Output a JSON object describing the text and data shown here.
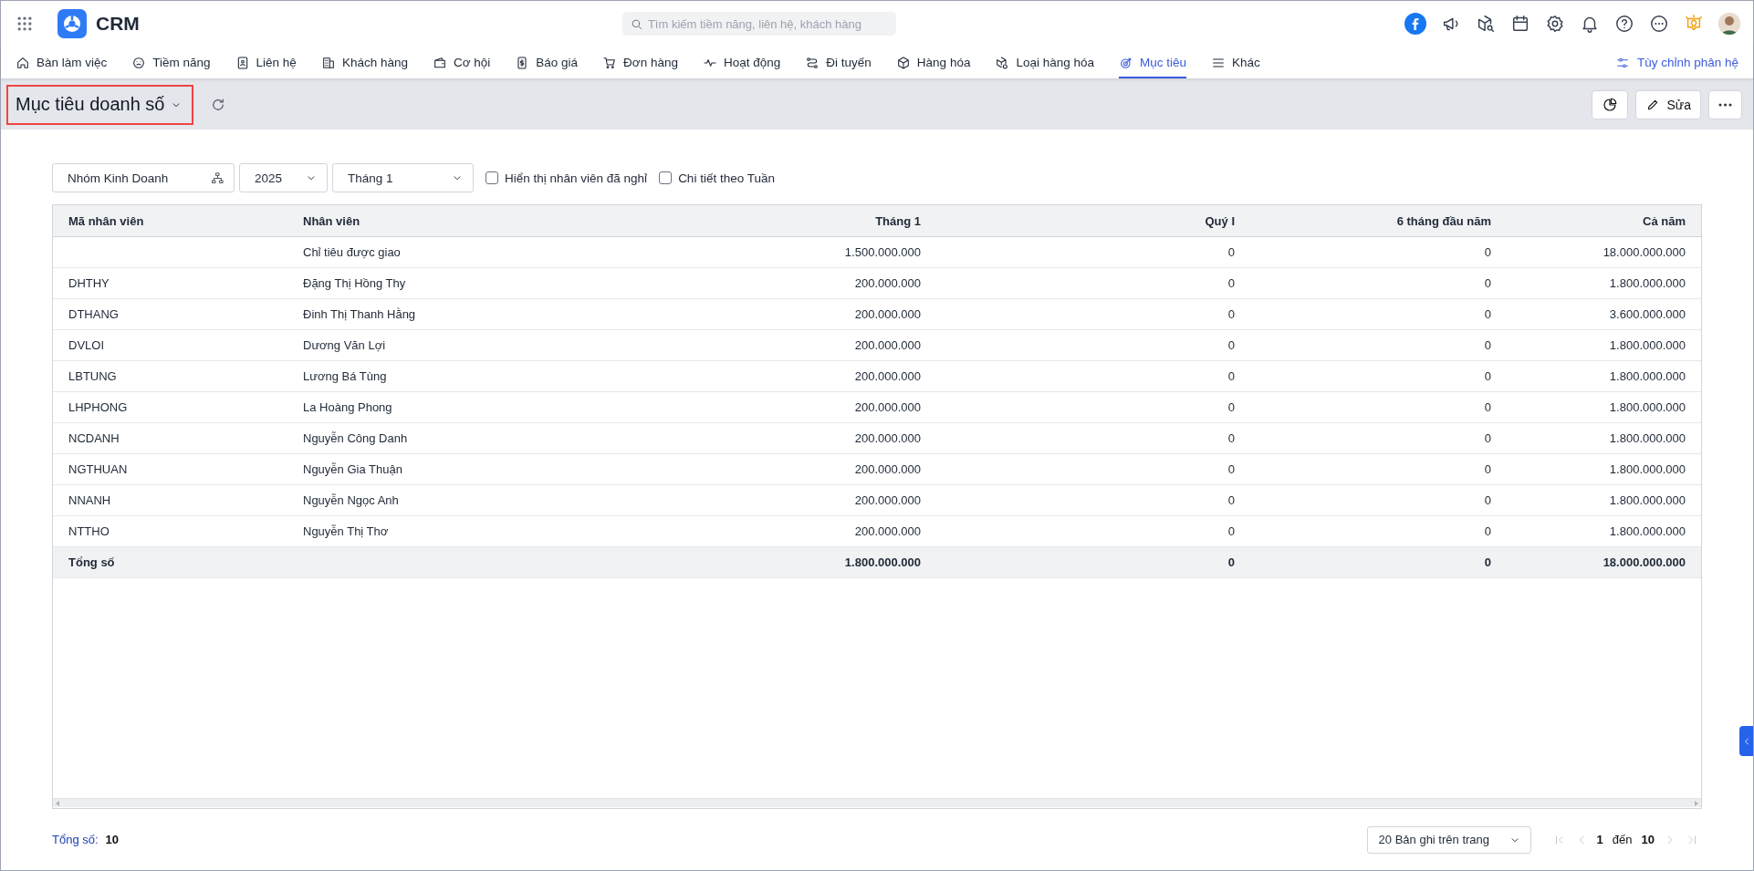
{
  "app": {
    "name": "CRM"
  },
  "search": {
    "placeholder": "Tìm kiếm tiềm năng, liên hệ, khách hàng"
  },
  "nav": [
    {
      "label": "Bàn làm việc",
      "selected": false
    },
    {
      "label": "Tiềm năng",
      "selected": false
    },
    {
      "label": "Liên hệ",
      "selected": false
    },
    {
      "label": "Khách hàng",
      "selected": false
    },
    {
      "label": "Cơ hội",
      "selected": false
    },
    {
      "label": "Báo giá",
      "selected": false
    },
    {
      "label": "Đơn hàng",
      "selected": false
    },
    {
      "label": "Hoạt động",
      "selected": false
    },
    {
      "label": "Đi tuyến",
      "selected": false
    },
    {
      "label": "Hàng hóa",
      "selected": false
    },
    {
      "label": "Loại hàng hóa",
      "selected": false
    },
    {
      "label": "Mục tiêu",
      "selected": true
    },
    {
      "label": "Khác",
      "selected": false
    }
  ],
  "customize": "Tùy chỉnh phân hệ",
  "toolbar": {
    "title": "Mục tiêu doanh số",
    "edit": "Sửa"
  },
  "filters": {
    "group": "Nhóm Kinh Doanh",
    "year": "2025",
    "period": "Tháng 1",
    "options": [
      {
        "label": "Hiển thị nhân viên đã nghỉ",
        "checked": false
      },
      {
        "label": "Chi tiết theo Tuần",
        "checked": false
      }
    ]
  },
  "table": {
    "columns": [
      "Mã nhân viên",
      "Nhân viên",
      "Tháng 1",
      "Quý I",
      "6 tháng đầu năm",
      "Cả năm"
    ],
    "rows": [
      {
        "name": "Chỉ tiêu được giao",
        "month": "1.500.000.000",
        "quarter": "0",
        "half": "0",
        "year": "18.000.000.000"
      },
      {
        "code": "DHTHY",
        "name": "Đặng Thị Hồng Thy",
        "month": "200.000.000",
        "quarter": "0",
        "half": "0",
        "year": "1.800.000.000"
      },
      {
        "code": "DTHANG",
        "name": "Đinh Thị Thanh Hằng",
        "month": "200.000.000",
        "quarter": "0",
        "half": "0",
        "year": "3.600.000.000"
      },
      {
        "code": "DVLOI",
        "name": "Dương Văn Lợi",
        "month": "200.000.000",
        "quarter": "0",
        "half": "0",
        "year": "1.800.000.000"
      },
      {
        "code": "LBTUNG",
        "name": "Lương Bá Tùng",
        "month": "200.000.000",
        "quarter": "0",
        "half": "0",
        "year": "1.800.000.000"
      },
      {
        "code": "LHPHONG",
        "name": "La Hoàng Phong",
        "month": "200.000.000",
        "quarter": "0",
        "half": "0",
        "year": "1.800.000.000"
      },
      {
        "code": "NCDANH",
        "name": "Nguyễn Công Danh",
        "month": "200.000.000",
        "quarter": "0",
        "half": "0",
        "year": "1.800.000.000"
      },
      {
        "code": "NGTHUAN",
        "name": "Nguyễn Gia Thuận",
        "month": "200.000.000",
        "quarter": "0",
        "half": "0",
        "year": "1.800.000.000"
      },
      {
        "code": "NNANH",
        "name": "Nguyễn Ngọc Anh",
        "month": "200.000.000",
        "quarter": "0",
        "half": "0",
        "year": "1.800.000.000"
      },
      {
        "code": "NTTHO",
        "name": "Nguyễn Thị Thơ",
        "month": "200.000.000",
        "quarter": "0",
        "half": "0",
        "year": "1.800.000.000"
      }
    ],
    "total": {
      "label": "Tổng số",
      "month": "1.800.000.000",
      "quarter": "0",
      "half": "0",
      "year": "18.000.000.000"
    }
  },
  "footer": {
    "count_label": "Tổng số:",
    "count": "10",
    "page_size": "20 Bản ghi trên trang",
    "page": "1",
    "to": "đến",
    "last": "10"
  }
}
